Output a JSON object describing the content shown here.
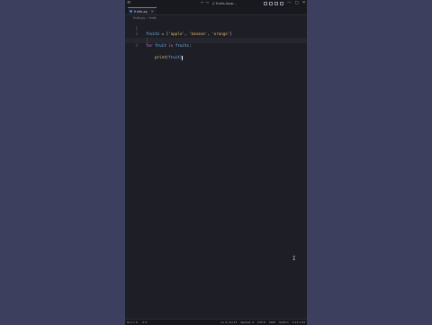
{
  "titlebar": {
    "nav_arrows": "← →",
    "title": "// fruits-loop...",
    "window_controls": [
      "—",
      "□",
      "✕"
    ]
  },
  "tab": {
    "label": "fruits.py",
    "close": "×"
  },
  "breadcrumb": {
    "items": [
      "fruits.py",
      "› fruits"
    ]
  },
  "code": {
    "line_numbers": [
      "1",
      "2",
      "3",
      "4"
    ],
    "line1": {
      "var": "fruits",
      "op": " = [",
      "s1": "'apple'",
      "sep1": ", ",
      "s2": "'banana'",
      "sep2": ", ",
      "s3": "'orange'",
      "end": "]"
    },
    "line3": {
      "kw_for": "for",
      "sp1": " ",
      "var": "fruit",
      "sp2": " ",
      "kw_in": "in",
      "sp3": " ",
      "iter": "fruits",
      "colon": ":"
    },
    "line4": {
      "fn": "print",
      "open": "(",
      "arg": "fruit",
      "close": ")"
    }
  },
  "statusbar": {
    "left": [
      "⊗ 0 ⚠ 0",
      "⊙ 0"
    ],
    "right": [
      "Ln 4, Col 17",
      "Spaces: 4",
      "UTF-8",
      "CRLF",
      "Python",
      "3.13.1 64"
    ]
  },
  "colors": {
    "accent": "#4f7fd0",
    "keyword": "#c678dd",
    "string": "#e3b56c",
    "background": "#1e1f26"
  }
}
